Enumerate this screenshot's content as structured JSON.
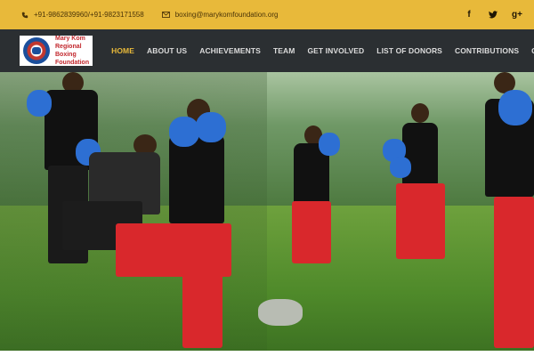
{
  "topbar": {
    "phone": "+91-9862839960/+91-9823171558",
    "email": "boxing@marykomfoundation.org",
    "socials": [
      "facebook-icon",
      "twitter-icon",
      "google-plus-icon"
    ],
    "social_glyphs": [
      "f",
      "🐦",
      "g+"
    ]
  },
  "header": {
    "logo_text": "Mary Kom Regional Boxing Foundation"
  },
  "nav": {
    "items": [
      "HOME",
      "ABOUT US",
      "ACHIEVEMENTS",
      "TEAM",
      "GET INVOLVED",
      "LIST OF DONORS",
      "CONTRIBUTIONS",
      "G"
    ]
  },
  "colors": {
    "accent": "#e8b93a",
    "header_bg": "#0e1216",
    "brand_red": "#c2272d"
  },
  "hero": {
    "image_alt": "Boxing training photo"
  }
}
